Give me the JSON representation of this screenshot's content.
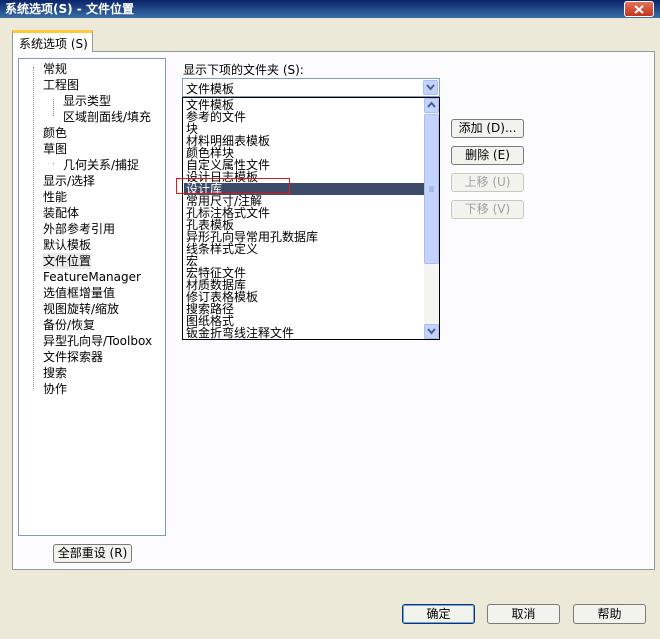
{
  "window": {
    "title": "系统选项(S) - 文件位置"
  },
  "tab": {
    "label": "系统选项 (S)"
  },
  "tree": {
    "items": [
      {
        "label": "常规"
      },
      {
        "label": "工程图"
      },
      {
        "label": "显示类型"
      },
      {
        "label": "区域剖面线/填充"
      },
      {
        "label": "颜色"
      },
      {
        "label": "草图"
      },
      {
        "label": "几何关系/捕捉"
      },
      {
        "label": "显示/选择"
      },
      {
        "label": "性能"
      },
      {
        "label": "装配体"
      },
      {
        "label": "外部参考引用"
      },
      {
        "label": "默认模板"
      },
      {
        "label": "文件位置"
      },
      {
        "label": "FeatureManager"
      },
      {
        "label": "选值框增量值"
      },
      {
        "label": "视图旋转/缩放"
      },
      {
        "label": "备份/恢复"
      },
      {
        "label": "异型孔向导/Toolbox"
      },
      {
        "label": "文件探索器"
      },
      {
        "label": "搜索"
      },
      {
        "label": "协作"
      }
    ],
    "selected": "文件位置"
  },
  "reset_all_label": "全部重设 (R)",
  "folders": {
    "label": "显示下项的文件夹 (S):",
    "selected": "文件模板",
    "list": [
      "文件模板",
      "参考的文件",
      "块",
      "材料明细表模板",
      "颜色样块",
      "自定义属性文件",
      "设计日志模板",
      "设计库",
      "常用尺寸/注解",
      "孔标注格式文件",
      "孔表模板",
      "异形孔向导常用孔数据库",
      "线条样式定义",
      "宏",
      "宏特征文件",
      "材质数据库",
      "修订表格模板",
      "搜索路径",
      "图纸格式",
      "钣金折弯线注释文件"
    ],
    "highlighted": "设计库"
  },
  "side_buttons": {
    "add": "添加 (D)...",
    "delete": "删除 (E)",
    "move_up": "上移 (U)",
    "move_down": "下移 (V)"
  },
  "footer": {
    "ok": "确定",
    "cancel": "取消",
    "help": "帮助"
  }
}
